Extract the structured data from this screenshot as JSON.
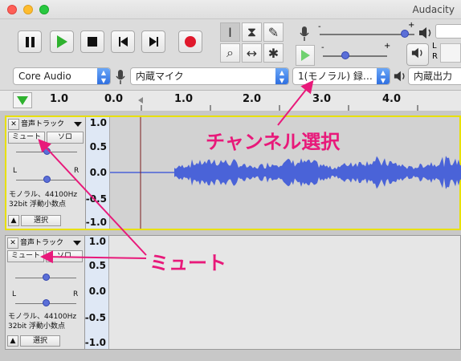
{
  "window": {
    "title": "Audacity"
  },
  "transport": {
    "buttons": [
      {
        "name": "pause-button",
        "icon": "pause-icon"
      },
      {
        "name": "play-button",
        "icon": "play-icon"
      },
      {
        "name": "stop-button",
        "icon": "stop-icon"
      },
      {
        "name": "skip-start-button",
        "icon": "skip-start-icon"
      },
      {
        "name": "skip-end-button",
        "icon": "skip-end-icon"
      },
      {
        "name": "record-button",
        "icon": "record-icon"
      }
    ]
  },
  "tools": {
    "row1": [
      {
        "name": "selection-tool",
        "glyph": "I"
      },
      {
        "name": "envelope-tool",
        "glyph": "⧗"
      },
      {
        "name": "draw-tool",
        "glyph": "✎"
      }
    ],
    "row2": [
      {
        "name": "zoom-tool",
        "glyph": "⌕"
      },
      {
        "name": "timeshift-tool",
        "glyph": "↔"
      },
      {
        "name": "multi-tool",
        "glyph": "✱"
      }
    ]
  },
  "meters": {
    "record_volume": 0.9,
    "playback_speed": 0.35,
    "minus": "-",
    "plus": "+",
    "left": "L",
    "right": "R"
  },
  "devices": {
    "host": "Core Audio",
    "recording_device": "内蔵マイク",
    "channels": "1(モノラル) 録…",
    "playback_device": "内蔵出力"
  },
  "ruler": {
    "labels": [
      "0.0",
      "1.0",
      "2.0",
      "3.0",
      "4.0"
    ],
    "left_label": "1.0"
  },
  "tracks": [
    {
      "name": "音声トラック",
      "mute": "ミュート",
      "solo": "ソロ",
      "info_line1": "モノラル、44100Hz",
      "info_line2": "32bit 浮動小数点",
      "select": "選択",
      "scale": [
        "1.0",
        "0.5",
        "0.0",
        "-0.5",
        "-1.0"
      ],
      "gain_l": "L",
      "gain_r": "R"
    },
    {
      "name": "音声トラック",
      "mute": "ミュート",
      "solo": "ソロ",
      "info_line1": "モノラル、44100Hz",
      "info_line2": "32bit 浮動小数点",
      "select": "選択",
      "scale": [
        "1.0",
        "0.5",
        "0.0",
        "-0.5",
        "-1.0"
      ],
      "gain_l": "L",
      "gain_r": "R"
    }
  ],
  "annotations": {
    "channel": "チャンネル選択",
    "mute": "ミュート"
  },
  "colors": {
    "accent": "#e8197a",
    "wave": "#4a63d8",
    "record": "#e0192c",
    "play": "#2fb22f"
  }
}
